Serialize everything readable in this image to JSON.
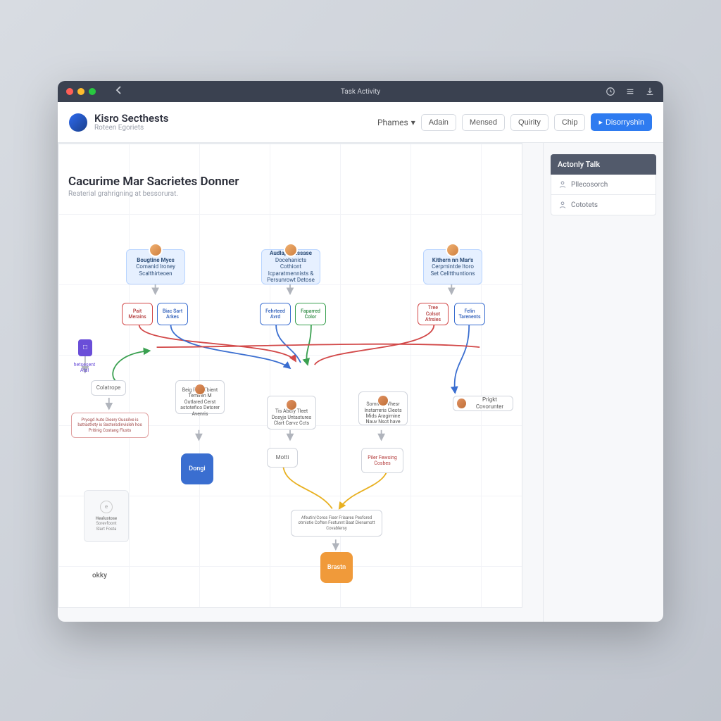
{
  "window": {
    "title": "Task Activity"
  },
  "brand": {
    "title": "Kisro Secthests",
    "subtitle": "Roteen Egoriets"
  },
  "nav": {
    "dropdown": "Phames",
    "items": [
      "Adain",
      "Mensed",
      "Quirity",
      "Chip"
    ],
    "primary": "Disorryshin"
  },
  "doc": {
    "title": "Cacurime Mar Sacrietes Donner",
    "subtitle": "Reaterial grahrigning at bessorurat."
  },
  "top_nodes": [
    {
      "t1": "Bougtine Mycs",
      "t2": "Comanid Ironey",
      "t3": "Scalthirteoen"
    },
    {
      "t1": "Audlaper Essase",
      "t2": "Docehanicts Cothiont",
      "t3": "Icparatmennists & Persunrowt Detose"
    },
    {
      "t1": "Kithern nn Mar's",
      "t2": "Cerpmintde Itoro",
      "t3": "Set Celitthuntions"
    }
  ],
  "sub_nodes": [
    [
      {
        "l1": "Pait",
        "l2": "Merains",
        "c": "red"
      },
      {
        "l1": "Biac Sart",
        "l2": "Arkes",
        "c": "blue"
      }
    ],
    [
      {
        "l1": "Fehrteed",
        "l2": "Avrd",
        "c": "blue"
      },
      {
        "l1": "Faparred",
        "l2": "Color",
        "c": "green"
      }
    ],
    [
      {
        "l1": "Tree Colsot",
        "l2": "Afrsies",
        "c": "red"
      },
      {
        "l1": "Felin",
        "l2": "Tarenents",
        "c": "blue"
      }
    ]
  ],
  "purple": {
    "icon": "□",
    "label": "hetsesent Atal"
  },
  "cat_box": "Colatrope",
  "desc_box": "Pryogd Auto Dieery Oussilve is batrastrety is Sectersdinvisleh hos Pritinig Costang Flusts",
  "mid_nodes": [
    {
      "t": "Beig Pain Tbient Temiren M Outlared Cerst astotefico Detorer Avenris"
    },
    {
      "t": "Tis Abery Tleet Dosyjs Untastures Clart Carvz Ccts"
    },
    {
      "t": "Sommile Vhesr Instarreris Cleots Mids Aragimine Nauv Nsot have"
    }
  ],
  "assign": "Prigkt Covorunter",
  "plain_box": "Motti",
  "result_box": {
    "l1": "Piler Fewsing",
    "l2": "Cosbes"
  },
  "wide_box": "Afeutin/Coros Fiser Frisares Pesfored otmistie Coften Festunnt Baat Dienamott Covablersy",
  "final_blue": "Dongi",
  "final_orange": "Brastn",
  "side_card": {
    "icon": "e",
    "l1": "Healustose",
    "l2": "Sorevfoont",
    "l3": "Slart Fosta"
  },
  "okay": "okky",
  "sidebar": {
    "head": "Actonly Talk",
    "items": [
      "Pllecosorch",
      "Cototets"
    ]
  }
}
